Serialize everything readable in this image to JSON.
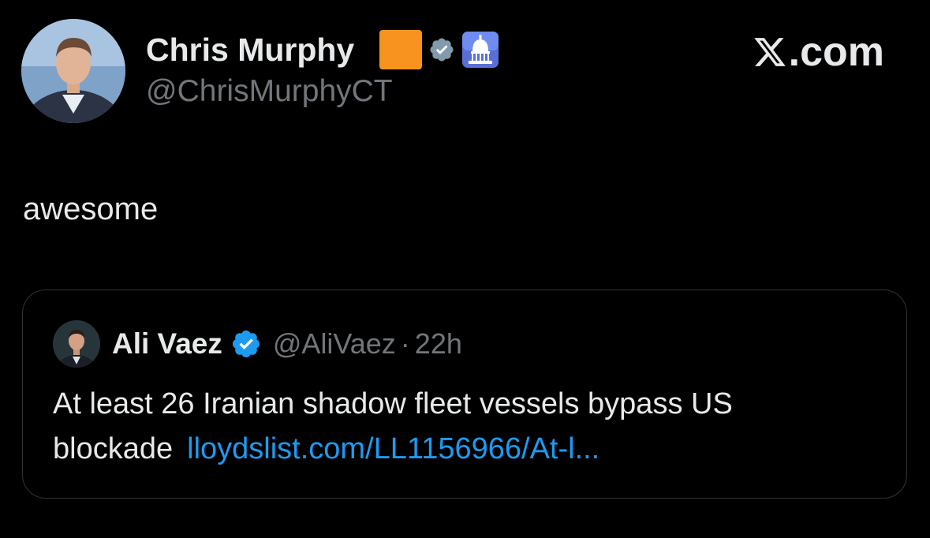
{
  "tweet": {
    "author": {
      "name": "Chris Murphy",
      "handle": "@ChrisMurphyCT",
      "avatar": "profile-photo-man-in-suit",
      "badges": [
        "orange-square-emoji",
        "verified-badge-icon",
        "capitol-dome-icon"
      ]
    },
    "site_label": ".com",
    "site_icon": "x-logo-icon",
    "text": "awesome",
    "quote": {
      "author": {
        "name": "Ali Vaez",
        "handle": "@AliVaez",
        "avatar": "profile-photo-man",
        "verified_icon": "verified-badge-icon"
      },
      "separator": "·",
      "time": "22h",
      "text": "At least 26 Iranian shadow fleet vessels bypass US blockade",
      "link": "lloydslist.com/LL1156966/At-l..."
    }
  },
  "colors": {
    "background": "#000000",
    "primary_text": "#e7e9ea",
    "secondary_text": "#71767b",
    "link": "#1d9bf0",
    "verified_blue": "#1d9bf0",
    "verified_gray": "#829aab",
    "orange": "#f7931e",
    "card_border": "#2f3336"
  }
}
